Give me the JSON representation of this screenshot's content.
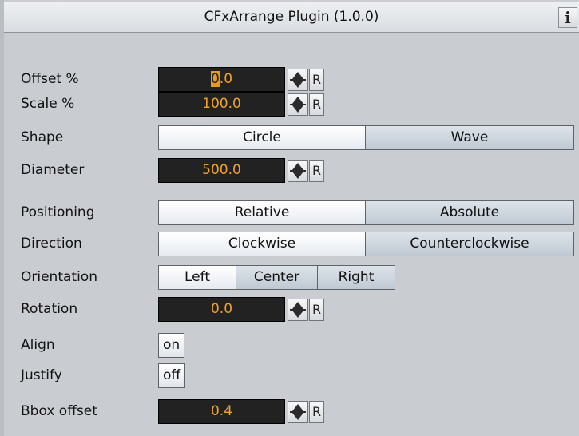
{
  "window": {
    "title": "CFxArrange Plugin (1.0.0)",
    "info_glyph": "i"
  },
  "fields": {
    "offset": {
      "label": "Offset %",
      "value_hl": "0",
      "value_rest": ".0",
      "reset": "R"
    },
    "scale": {
      "label": "Scale %",
      "value": "100.0",
      "reset": "R"
    },
    "shape": {
      "label": "Shape",
      "options": [
        "Circle",
        "Wave"
      ],
      "selected": "Circle"
    },
    "diameter": {
      "label": "Diameter",
      "value": "500.0",
      "reset": "R"
    },
    "positioning": {
      "label": "Positioning",
      "options": [
        "Relative",
        "Absolute"
      ],
      "selected": "Relative"
    },
    "direction": {
      "label": "Direction",
      "options": [
        "Clockwise",
        "Counterclockwise"
      ],
      "selected": "Clockwise"
    },
    "orientation": {
      "label": "Orientation",
      "options": [
        "Left",
        "Center",
        "Right"
      ],
      "selected": "Left"
    },
    "rotation": {
      "label": "Rotation",
      "value": "0.0",
      "reset": "R"
    },
    "align": {
      "label": "Align",
      "value": "on"
    },
    "justify": {
      "label": "Justify",
      "value": "off"
    },
    "bbox_offset": {
      "label": "Bbox offset",
      "value": "0.4",
      "reset": "R"
    }
  },
  "colors": {
    "panel_bg": "#c9cdd2",
    "field_bg": "#222222",
    "field_text": "#f1a22b",
    "selection": "#e89a1f"
  }
}
